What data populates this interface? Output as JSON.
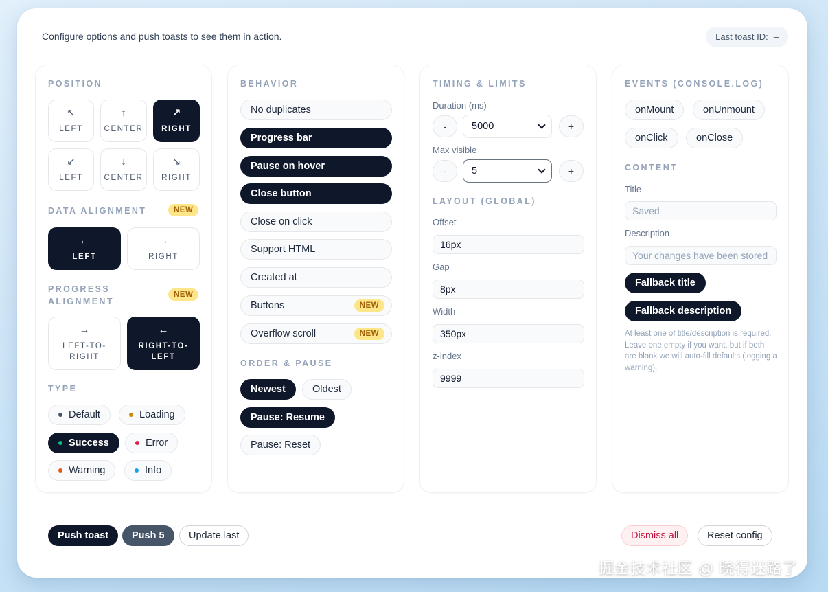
{
  "header": {
    "intro": "Configure options and push toasts to see them in action.",
    "last_toast_label": "Last toast ID:",
    "last_toast_value": "–"
  },
  "position": {
    "title": "POSITION",
    "tiles": [
      {
        "icon": "↖",
        "label": "LEFT",
        "selected": false
      },
      {
        "icon": "↑",
        "label": "CENTER",
        "selected": false
      },
      {
        "icon": "↗",
        "label": "RIGHT",
        "selected": true
      },
      {
        "icon": "↙",
        "label": "LEFT",
        "selected": false
      },
      {
        "icon": "↓",
        "label": "CENTER",
        "selected": false
      },
      {
        "icon": "↘",
        "label": "RIGHT",
        "selected": false
      }
    ]
  },
  "data_alignment": {
    "title": "DATA ALIGNMENT",
    "badge": "NEW",
    "options": [
      {
        "icon": "←",
        "label": "LEFT",
        "selected": true
      },
      {
        "icon": "→",
        "label": "RIGHT",
        "selected": false
      }
    ]
  },
  "progress_alignment": {
    "title_line1": "PROGRESS",
    "title_line2": "ALIGNMENT",
    "badge": "NEW",
    "options": [
      {
        "icon": "→",
        "line1": "LEFT-TO-",
        "line2": "RIGHT",
        "selected": false
      },
      {
        "icon": "←",
        "line1": "RIGHT-TO-",
        "line2": "LEFT",
        "selected": true
      }
    ]
  },
  "type": {
    "title": "TYPE",
    "options": [
      {
        "label": "Default",
        "dot": "#475569",
        "selected": false
      },
      {
        "label": "Loading",
        "dot": "#ca8a04",
        "selected": false
      },
      {
        "label": "Success",
        "dot": "#10b981",
        "selected": true
      },
      {
        "label": "Error",
        "dot": "#e11d48",
        "selected": false
      },
      {
        "label": "Warning",
        "dot": "#ea580c",
        "selected": false
      },
      {
        "label": "Info",
        "dot": "#0ea5e9",
        "selected": false
      }
    ]
  },
  "behavior": {
    "title": "BEHAVIOR",
    "items": [
      {
        "label": "No duplicates",
        "on": false,
        "badge": ""
      },
      {
        "label": "Progress bar",
        "on": true,
        "badge": ""
      },
      {
        "label": "Pause on hover",
        "on": true,
        "badge": ""
      },
      {
        "label": "Close button",
        "on": true,
        "badge": ""
      },
      {
        "label": "Close on click",
        "on": false,
        "badge": ""
      },
      {
        "label": "Support HTML",
        "on": false,
        "badge": ""
      },
      {
        "label": "Created at",
        "on": false,
        "badge": ""
      },
      {
        "label": "Buttons",
        "on": false,
        "badge": "NEW"
      },
      {
        "label": "Overflow scroll",
        "on": false,
        "badge": "NEW"
      }
    ]
  },
  "order_pause": {
    "title": "ORDER & PAUSE",
    "newest": "Newest",
    "oldest": "Oldest",
    "resume": "Pause: Resume",
    "reset": "Pause: Reset"
  },
  "timing": {
    "title": "TIMING & LIMITS",
    "duration_label": "Duration (ms)",
    "duration_value": "5000",
    "max_label": "Max visible",
    "max_value": "5",
    "minus": "-",
    "plus": "+"
  },
  "layout": {
    "title": "LAYOUT (GLOBAL)",
    "offset_label": "Offset",
    "offset_value": "16px",
    "gap_label": "Gap",
    "gap_value": "8px",
    "width_label": "Width",
    "width_value": "350px",
    "z_label": "z-index",
    "z_value": "9999"
  },
  "events": {
    "title": "EVENTS (CONSOLE.LOG)",
    "mount": "onMount",
    "unmount": "onUnmount",
    "click": "onClick",
    "close": "onClose"
  },
  "content": {
    "title": "CONTENT",
    "title_label": "Title",
    "title_placeholder": "Saved",
    "desc_label": "Description",
    "desc_placeholder": "Your changes have been stored",
    "fallback_title": "Fallback title",
    "fallback_desc": "Fallback description",
    "note": "At least one of title/description is required. Leave one empty if you want, but if both are blank we will auto-fill defaults (logging a warning)."
  },
  "footer": {
    "push": "Push toast",
    "push5": "Push 5",
    "update": "Update last",
    "dismiss": "Dismiss all",
    "reset": "Reset config"
  },
  "watermark": "掘金技术社区 @ 晓得迷路了"
}
